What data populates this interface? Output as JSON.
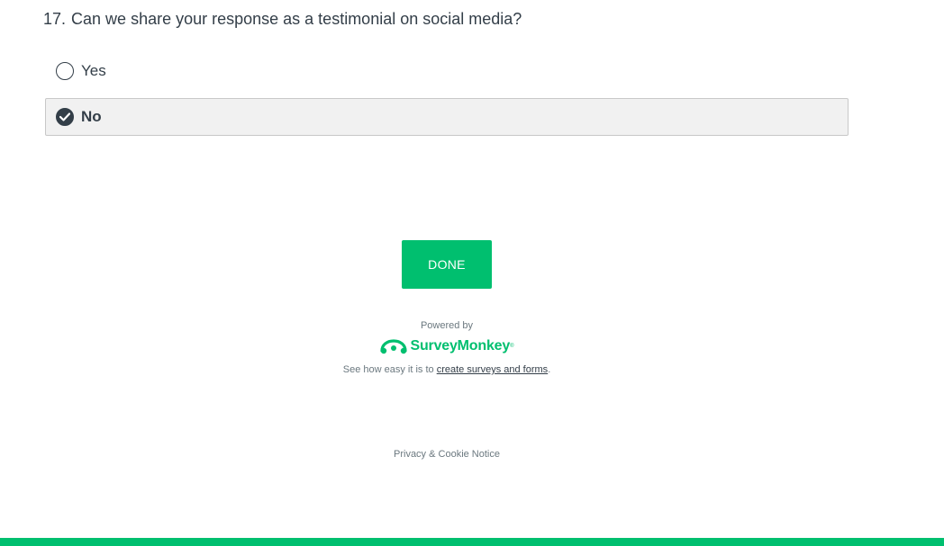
{
  "question": {
    "number": "17.",
    "text": "Can we share your response as a testimonial on social media?"
  },
  "options": [
    {
      "label": "Yes",
      "selected": false
    },
    {
      "label": "No",
      "selected": true
    }
  ],
  "done_button": {
    "label": "DONE"
  },
  "footer": {
    "powered_by": "Powered by",
    "logo_text": "SurveyMonkey",
    "logo_icon": "surveymonkey-logo-icon",
    "tagline_prefix": "See how easy it is to ",
    "tagline_link": "create surveys and forms",
    "tagline_suffix": ".",
    "privacy": "Privacy & Cookie Notice"
  },
  "colors": {
    "accent": "#00bf6f",
    "text": "#333e48",
    "selected_bg": "#f1f1f1"
  }
}
